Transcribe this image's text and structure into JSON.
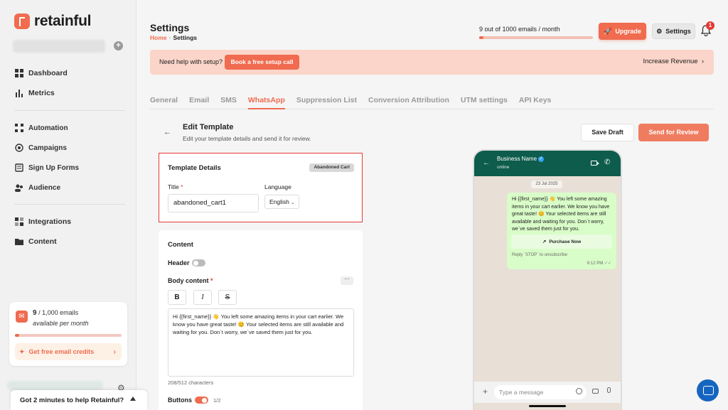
{
  "brand": {
    "name": "retainful"
  },
  "sidebar": {
    "items": [
      {
        "label": "Dashboard",
        "icon": "dashboard-icon"
      },
      {
        "label": "Metrics",
        "icon": "bar-chart-icon"
      },
      {
        "label": "Automation",
        "icon": "automation-icon"
      },
      {
        "label": "Campaigns",
        "icon": "campaigns-icon"
      },
      {
        "label": "Sign Up Forms",
        "icon": "forms-icon"
      },
      {
        "label": "Audience",
        "icon": "audience-icon"
      },
      {
        "label": "Integrations",
        "icon": "integrations-icon"
      },
      {
        "label": "Content",
        "icon": "folder-icon"
      }
    ],
    "credits": {
      "used": "9",
      "total": "/ 1,000 emails",
      "period": "available per month",
      "progress": 0.009,
      "cta": "Get free email credits"
    },
    "feedback": "Got 2 minutes to help Retainful?"
  },
  "header": {
    "title": "Settings",
    "breadcrumb": {
      "home": "Home",
      "current": "Settings"
    },
    "usage_text": "9 out of 1000 emails / month",
    "usage_progress": 0.009,
    "upgrade_label": "Upgrade",
    "settings_label": "Settings",
    "notifications_count": "1"
  },
  "help_banner": {
    "text": "Need help with setup?",
    "button": "Book a free setup call",
    "link": "Increase Revenue"
  },
  "tabs": [
    {
      "label": "General",
      "active": false
    },
    {
      "label": "Email",
      "active": false
    },
    {
      "label": "SMS",
      "active": false
    },
    {
      "label": "WhatsApp",
      "active": true
    },
    {
      "label": "Suppression List",
      "active": false
    },
    {
      "label": "Conversion Attribution",
      "active": false
    },
    {
      "label": "UTM settings",
      "active": false
    },
    {
      "label": "API Keys",
      "active": false
    }
  ],
  "edit_template": {
    "title": "Edit Template",
    "subtitle": "Edit your template details and send it for review.",
    "save_draft": "Save Draft",
    "send_review": "Send for Review"
  },
  "template_details": {
    "title": "Template Details",
    "badge": "Abandoned Cart",
    "title_label": "Title",
    "title_value": "abandoned_cart1",
    "language_label": "Language",
    "language_value": "English"
  },
  "content": {
    "title": "Content",
    "header_label": "Header",
    "header_enabled": false,
    "body_label": "Body content",
    "more": "···",
    "format_buttons": [
      "B",
      "I",
      "S"
    ],
    "body_text": "Hi {{first_name}} 👋 You left some amazing items in your cart earlier. We know you have great taste! 😊 Your selected items are still available and waiting for you. Don`t worry, we`ve saved them just for you.",
    "char_count": "208/512 characters",
    "buttons_label": "Buttons",
    "buttons_enabled": true,
    "buttons_count": "1/2"
  },
  "preview": {
    "business_name": "Business Name",
    "status": "online",
    "date": "23 Jul 2025",
    "message": "Hi {{first_name}} 👋 You left some amazing items in your cart earlier. We know you have great taste! 😊 Your selected items are still available and waiting for you. Don`t worry, we`ve saved them just for you.",
    "button": "Purchase Now",
    "reply_note": "Reply `STOP` to unsubscribe",
    "time": "6:12 PM",
    "input_placeholder": "Type a message"
  },
  "colors": {
    "accent": "#f06b4f",
    "whatsapp_header": "#0e5c4c",
    "bubble": "#d9fdc8"
  }
}
